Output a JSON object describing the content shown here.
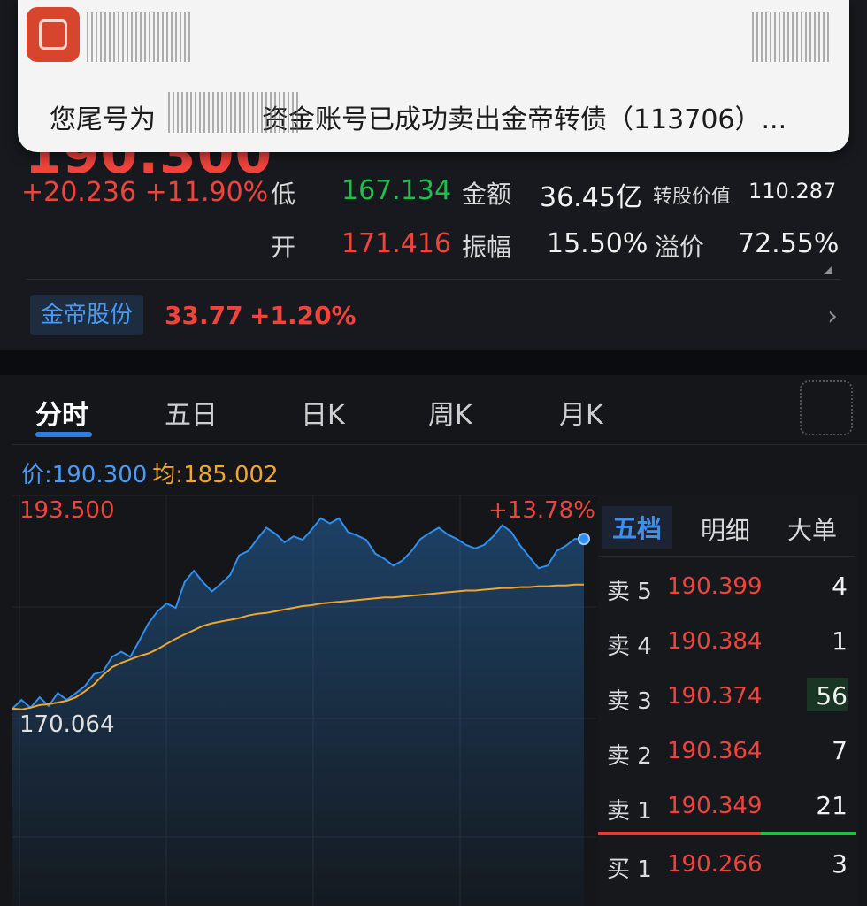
{
  "quote": {
    "price": "190.300",
    "change": "+20.236 +11.90%",
    "low_label": "低",
    "low_value": "167.134",
    "open_label": "开",
    "open_value": "171.416",
    "amount_label": "金额",
    "amount_value": "36.45亿",
    "amplitude_label": "振幅",
    "amplitude_value": "15.50%",
    "conv_value_label": "转股价值",
    "conv_value": "110.287",
    "premium_label": "溢价",
    "premium_value": "72.55%"
  },
  "underlying": {
    "name": "金帝股份",
    "price": "33.77",
    "change": "+1.20%"
  },
  "tabs": [
    "分时",
    "五日",
    "日K",
    "周K",
    "月K"
  ],
  "price_line": {
    "price_label": "价:",
    "price_value": "190.300",
    "avg_label": "均:",
    "avg_value": "185.002"
  },
  "chart_labels": {
    "high": "193.500",
    "low": "170.064",
    "pct": "+13.78%"
  },
  "chart_data": {
    "type": "line",
    "ylim": [
      170.064,
      193.5
    ],
    "series": [
      {
        "values": [
          170.6,
          171.6,
          170.7,
          171.9,
          170.9,
          172.4,
          171.6,
          172.4,
          173.2,
          174.6,
          174.9,
          176.6,
          177.2,
          176.6,
          178.5,
          180.5,
          181.9,
          182.8,
          182.3,
          185.3,
          186.6,
          185.3,
          184.2,
          185.1,
          186.1,
          188.4,
          188.9,
          190.3,
          191.6,
          190.9,
          189.9,
          190.6,
          190.2,
          191.4,
          192.7,
          192.1,
          192.7,
          191.1,
          190.7,
          190.2,
          188.6,
          188.0,
          187.2,
          187.8,
          188.9,
          190.3,
          191.0,
          191.6,
          190.8,
          190.3,
          189.6,
          189.2,
          189.6,
          190.6,
          191.9,
          191.1,
          189.5,
          188.2,
          186.9,
          187.2,
          188.9,
          189.5,
          190.3,
          190.3
        ]
      },
      {
        "values": [
          170.6,
          170.5,
          170.7,
          171.0,
          171.1,
          171.3,
          171.5,
          171.9,
          172.6,
          173.4,
          174.5,
          175.4,
          175.9,
          176.3,
          176.7,
          177.0,
          177.5,
          178.1,
          178.7,
          179.2,
          179.7,
          180.2,
          180.5,
          180.7,
          180.9,
          181.1,
          181.4,
          181.6,
          181.7,
          181.9,
          182.1,
          182.3,
          182.5,
          182.6,
          182.8,
          182.9,
          183.0,
          183.1,
          183.2,
          183.3,
          183.4,
          183.5,
          183.5,
          183.6,
          183.7,
          183.8,
          183.9,
          184.0,
          184.1,
          184.2,
          184.3,
          184.3,
          184.4,
          184.5,
          184.6,
          184.6,
          184.7,
          184.7,
          184.8,
          184.8,
          184.9,
          184.9,
          185.0,
          185.0
        ]
      }
    ]
  },
  "order_book": {
    "tabs": [
      "五档",
      "明细",
      "大单"
    ],
    "rows": [
      {
        "label": "卖 5",
        "price": "190.399",
        "qty": "4"
      },
      {
        "label": "卖 4",
        "price": "190.384",
        "qty": "1"
      },
      {
        "label": "卖 3",
        "price": "190.374",
        "qty": "56"
      },
      {
        "label": "卖 2",
        "price": "190.364",
        "qty": "7"
      },
      {
        "label": "卖 1",
        "price": "190.349",
        "qty": "21"
      },
      {
        "label": "买 1",
        "price": "190.266",
        "qty": "3"
      }
    ]
  },
  "notification": {
    "text": "您尾号为　　　　资金账号已成功卖出金帝转债（113706）..."
  },
  "colors": {
    "up": "#f0433c",
    "down": "#1fbf4a",
    "price_line": "#2f8ff0",
    "avg_line": "#f0a52e"
  }
}
